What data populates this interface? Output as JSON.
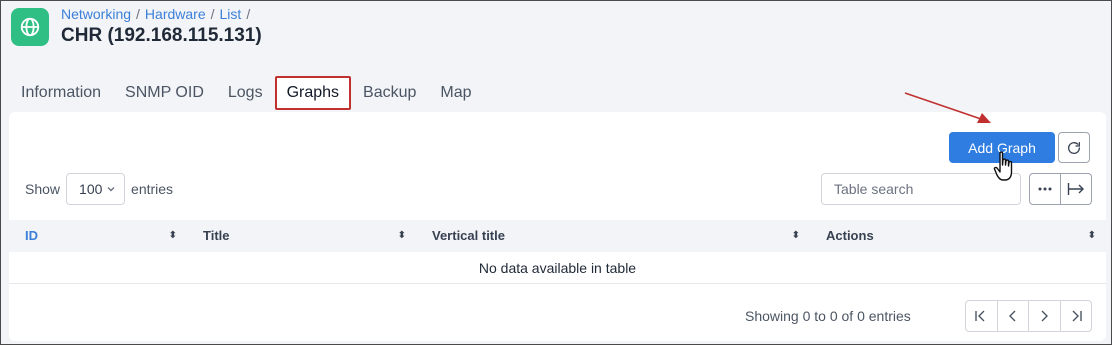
{
  "breadcrumb": [
    "Networking",
    "Hardware",
    "List"
  ],
  "breadcrumb_sep": "/",
  "page_title": "CHR (192.168.115.131)",
  "tabs": [
    {
      "label": "Information",
      "active": false
    },
    {
      "label": "SNMP OID",
      "active": false
    },
    {
      "label": "Logs",
      "active": false
    },
    {
      "label": "Graphs",
      "active": true
    },
    {
      "label": "Backup",
      "active": false
    },
    {
      "label": "Map",
      "active": false
    }
  ],
  "toolbar": {
    "add_label": "Add Graph",
    "refresh_icon": "refresh-icon"
  },
  "entries": {
    "show_label": "Show",
    "value": "100",
    "suffix": "entries"
  },
  "search": {
    "placeholder": "Table search",
    "value": ""
  },
  "table": {
    "columns": [
      "ID",
      "Title",
      "Vertical title",
      "Actions"
    ],
    "empty_message": "No data available in table",
    "info": "Showing 0 to 0 of 0 entries"
  },
  "colors": {
    "accent": "#2f7de1",
    "app_icon": "#2fbf85",
    "highlight": "#c0302f"
  }
}
